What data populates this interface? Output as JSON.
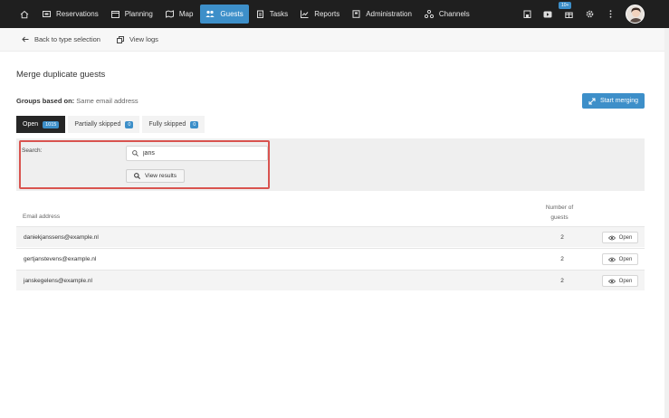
{
  "nav": {
    "items": [
      {
        "label": "Reservations",
        "icon": "reservations-icon"
      },
      {
        "label": "Planning",
        "icon": "calendar-icon"
      },
      {
        "label": "Map",
        "icon": "map-icon"
      },
      {
        "label": "Guests",
        "icon": "guests-icon",
        "active": true
      },
      {
        "label": "Tasks",
        "icon": "clipboard-icon"
      },
      {
        "label": "Reports",
        "icon": "chart-icon"
      },
      {
        "label": "Administration",
        "icon": "book-icon"
      },
      {
        "label": "Channels",
        "icon": "channels-icon"
      }
    ],
    "notification_badge": "10+"
  },
  "subbar": {
    "back_label": "Back to type selection",
    "logs_label": "View logs"
  },
  "page": {
    "title": "Merge duplicate guests",
    "groups_label": "Groups based on:",
    "groups_value": "Same email address",
    "start_merging": "Start merging"
  },
  "tabs": [
    {
      "label": "Open",
      "count": "1015",
      "active": true
    },
    {
      "label": "Partially skipped",
      "count": "0"
    },
    {
      "label": "Fully skipped",
      "count": "0"
    }
  ],
  "search": {
    "label": "Search:",
    "value": "jans",
    "button": "View results"
  },
  "table": {
    "col_email": "Email address",
    "col_num_line1": "Number of",
    "col_num_line2": "guests",
    "open_label": "Open",
    "rows": [
      {
        "email": "daniekjanssens@example.nl",
        "count": "2"
      },
      {
        "email": "gertjanstevens@example.nl",
        "count": "2"
      },
      {
        "email": "janskegelens@example.nl",
        "count": "2"
      }
    ]
  },
  "colors": {
    "accent": "#3d8fc9",
    "nav_bg": "#1f1f1f",
    "highlight": "#d9534f"
  }
}
